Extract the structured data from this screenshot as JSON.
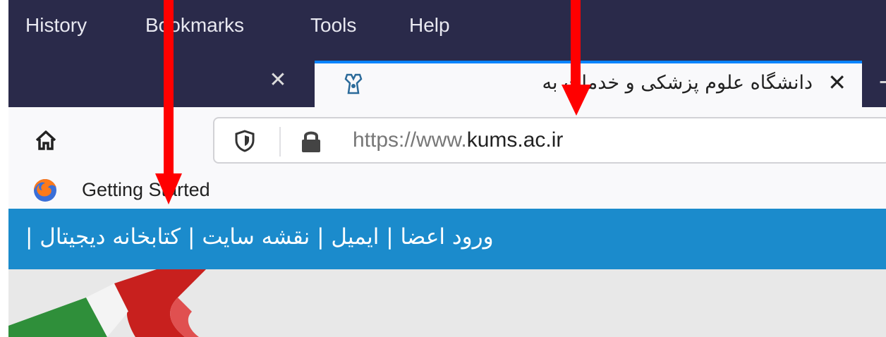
{
  "menubar": {
    "items": [
      "History",
      "Bookmarks",
      "Tools",
      "Help"
    ]
  },
  "tabs": {
    "active_title": "دانشگاه علوم پزشکی و خدمات به",
    "close_glyph": "✕",
    "new_tab_glyph": "+"
  },
  "navbar": {
    "url_prefix": "https://www.",
    "url_domain": "kums.ac.ir"
  },
  "bookmarks": {
    "items": [
      "Getting Started"
    ]
  },
  "site_nav": {
    "links_text": "ورود اعضا | ایمیل | نقشه سایت | کتابخانه دیجیتال |"
  },
  "icons": [
    "home-icon",
    "shield-icon",
    "lock-icon",
    "firefox-icon",
    "close-icon",
    "favicon",
    "arrow-down-icon"
  ],
  "colors": {
    "menubar_bg": "#2a2a4a",
    "site_nav_bg": "#1b8bcc",
    "arrow": "#ff0000",
    "tab_accent": "#0a84ff"
  }
}
